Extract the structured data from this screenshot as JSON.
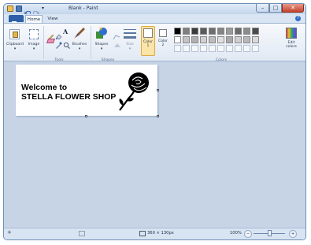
{
  "window": {
    "title": "Blank - Paint",
    "minimize_glyph": "–",
    "maximize_glyph": "□",
    "close_glyph": "✕"
  },
  "tabs": {
    "home": "Home",
    "view": "View"
  },
  "ribbon": {
    "clipboard": "Clipboard",
    "image": "Image",
    "brushes": "Brushes",
    "shapes": "Shapes",
    "size": "Size",
    "color1": "Color\n1",
    "color2": "Color\n2",
    "edit_colors": "Edit\ncolors",
    "groups": {
      "tools": "Tools",
      "shapes": "Shapes",
      "colors": "Colors"
    },
    "text_tool_glyph": "A",
    "color1_value": "#ffffff",
    "color2_value": "#ffffff",
    "palette_row1": [
      "#000000",
      "#7f7f7f",
      "#3a3a3a",
      "#5a5a5a",
      "#6e6e6e",
      "#848484",
      "#9a9a9a",
      "#6b6b6b",
      "#8c8c8c",
      "#4a4a4a"
    ],
    "palette_row2": [
      "#ffffff",
      "#c3c3c3",
      "#b0b0b0",
      "#d0d0d0",
      "#bdbdbd",
      "#e0e0e0",
      "#a8a8a8",
      "#cfcfcf",
      "#b8b8b8",
      "#dadada"
    ]
  },
  "canvas": {
    "line1": "Welcome to",
    "line2": "STELLA FLOWER SHOP",
    "rose_icon": "rose-icon"
  },
  "status": {
    "image_size": "360 × 130px",
    "zoom": "100%",
    "zoom_level_percent": 100,
    "zoom_out_glyph": "−",
    "zoom_in_glyph": "+"
  }
}
